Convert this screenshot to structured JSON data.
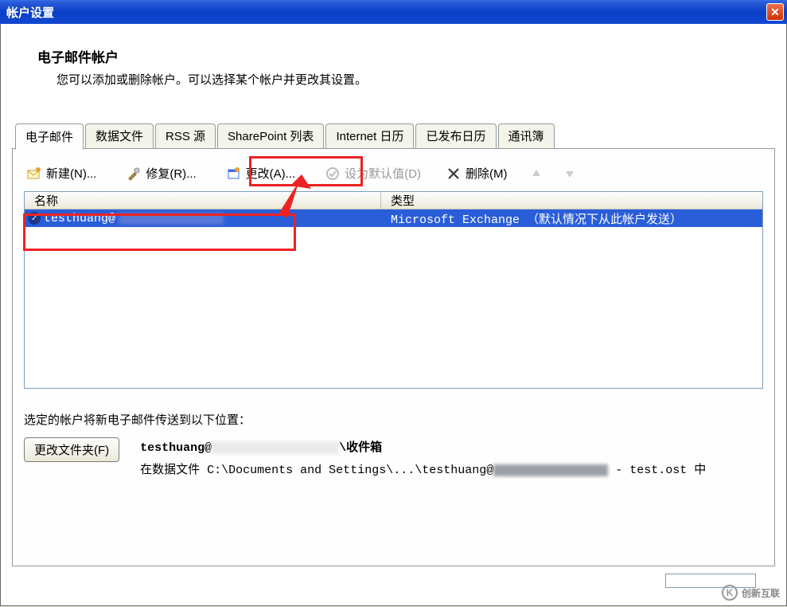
{
  "title": "帐户设置",
  "header": {
    "heading": "电子邮件帐户",
    "subtext": "您可以添加或删除帐户。可以选择某个帐户并更改其设置。"
  },
  "tabs": [
    {
      "label": "电子邮件",
      "active": true
    },
    {
      "label": "数据文件",
      "active": false
    },
    {
      "label": "RSS 源",
      "active": false
    },
    {
      "label": "SharePoint 列表",
      "active": false
    },
    {
      "label": "Internet 日历",
      "active": false
    },
    {
      "label": "已发布日历",
      "active": false
    },
    {
      "label": "通讯簿",
      "active": false
    }
  ],
  "toolbar": {
    "new": "新建(N)...",
    "repair": "修复(R)...",
    "change": "更改(A)...",
    "set_default": "设为默认值(D)",
    "delete": "删除(M)"
  },
  "table": {
    "col_name": "名称",
    "col_type": "类型",
    "row_name": "testhuang@",
    "row_type": "Microsoft Exchange （默认情况下从此帐户发送）"
  },
  "footer": {
    "delivery_text": "选定的帐户将新电子邮件传送到以下位置：",
    "change_folder_btn": "更改文件夹(F)",
    "path_line1_prefix": "testhuang@",
    "path_line1_suffix": "\\收件箱",
    "path_line2_prefix": "在数据文件 C:\\Documents and Settings\\...\\testhuang@",
    "path_line2_suffix": " - test.ost 中"
  },
  "watermark": "创新互联"
}
